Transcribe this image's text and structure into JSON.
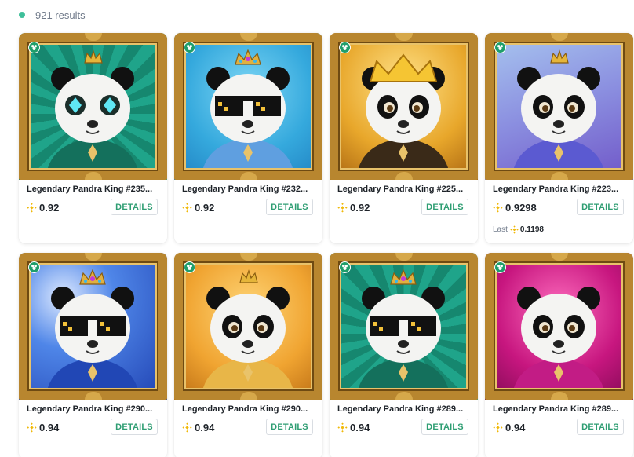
{
  "results": {
    "count_text": "921 results"
  },
  "details_label": "DETAILS",
  "colors": {
    "accent": "#2f9e73",
    "frame_gold": "#b8862f",
    "bnb_yellow": "#f0b90b"
  },
  "cards": [
    {
      "name": "Legendary Pandra King #235...",
      "price": "0.92",
      "bg": "teal-rays",
      "glasses": "diamond",
      "crown": "small-gold"
    },
    {
      "name": "Legendary Pandra King #232...",
      "price": "0.92",
      "bg": "sky-blue",
      "glasses": "pixel",
      "crown": "jeweled"
    },
    {
      "name": "Legendary Pandra King #225...",
      "price": "0.92",
      "bg": "golden",
      "glasses": "none",
      "crown": "large-gold"
    },
    {
      "name": "Legendary Pandra King #223...",
      "price": "0.9298",
      "last_label": "Last",
      "last_price": "0.1198",
      "bg": "lavender",
      "glasses": "none",
      "crown": "small-gold"
    },
    {
      "name": "Legendary Pandra King #290...",
      "price": "0.94",
      "bg": "royal-blue",
      "glasses": "pixel",
      "crown": "jeweled"
    },
    {
      "name": "Legendary Pandra King #290...",
      "price": "0.94",
      "bg": "amber",
      "glasses": "none",
      "crown": "small-gold"
    },
    {
      "name": "Legendary Pandra King #289...",
      "price": "0.94",
      "bg": "teal-rays",
      "glasses": "pixel",
      "crown": "jeweled"
    },
    {
      "name": "Legendary Pandra King #289...",
      "price": "0.94",
      "bg": "magenta",
      "glasses": "none",
      "crown": "none"
    }
  ]
}
